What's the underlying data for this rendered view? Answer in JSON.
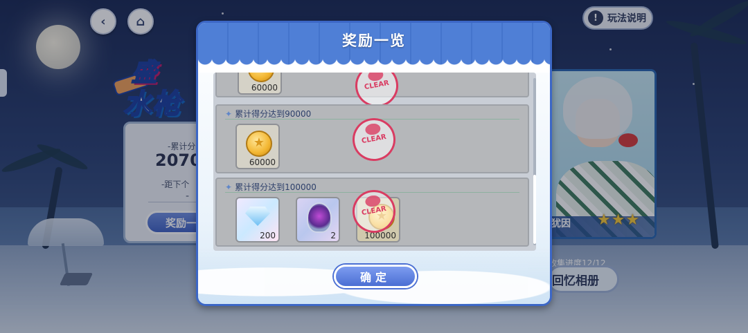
{
  "header": {
    "help_label": "玩法说明"
  },
  "event_panel": {
    "title_line1": "盛",
    "title_line2": "水枪",
    "score_label": "-累计分",
    "score_value": "2070",
    "next_label": "-距下个",
    "next_value": "-",
    "reward_button_label": "奖励一"
  },
  "card_panel": {
    "character_name": "犹因",
    "stars": "★★★",
    "collect_progress": "收集进度12/12",
    "album_button_label": "回忆相册"
  },
  "modal": {
    "title": "奖励一览",
    "confirm_label": "确定",
    "rows": [
      {
        "condition": "",
        "items": [
          {
            "type": "coin",
            "qty": "60000"
          }
        ],
        "cleared": true,
        "stamp_text": "CLEAR"
      },
      {
        "condition": "累计得分达到90000",
        "items": [
          {
            "type": "coin",
            "qty": "60000"
          }
        ],
        "cleared": true,
        "stamp_text": "CLEAR"
      },
      {
        "condition": "累计得分达到100000",
        "items": [
          {
            "type": "diamond",
            "qty": "200"
          },
          {
            "type": "crystal",
            "qty": "2"
          },
          {
            "type": "gold-coin",
            "qty": "100000"
          }
        ],
        "cleared": true,
        "stamp_text": "CLEAR"
      }
    ]
  },
  "colors": {
    "accent": "#4f7fd6",
    "stamp": "#d93c62",
    "star": "#f6c93a"
  }
}
